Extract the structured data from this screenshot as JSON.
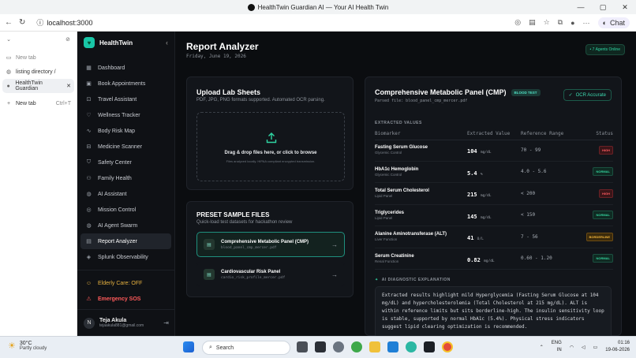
{
  "browser": {
    "window_title": "HealthTwin Guardian AI — Your AI Health Twin",
    "url": "localhost:3000",
    "chat_label": "Chat",
    "tabs": [
      {
        "label": "New tab"
      },
      {
        "label": "listing directory /"
      },
      {
        "label": "HealthTwin Guardian"
      },
      {
        "label": "New tab",
        "shortcut": "Ctrl+T"
      }
    ]
  },
  "app": {
    "brand": "HealthTwin",
    "nav": [
      {
        "label": "Dashboard",
        "icon": "grid-icon"
      },
      {
        "label": "Book Appointments",
        "icon": "calendar-icon"
      },
      {
        "label": "Travel Assistant",
        "icon": "suitcase-icon"
      },
      {
        "label": "Wellness Tracker",
        "icon": "heart-icon"
      },
      {
        "label": "Body Risk Map",
        "icon": "pulse-icon"
      },
      {
        "label": "Medicine Scanner",
        "icon": "scan-icon"
      },
      {
        "label": "Safety Center",
        "icon": "shield-icon"
      },
      {
        "label": "Family Health",
        "icon": "users-icon"
      },
      {
        "label": "AI Assistant",
        "icon": "globe-icon"
      },
      {
        "label": "Mission Control",
        "icon": "target-icon"
      },
      {
        "label": "AI Agent Swarm",
        "icon": "globe-icon"
      },
      {
        "label": "Report Analyzer",
        "icon": "file-icon",
        "active": true
      },
      {
        "label": "Splunk Observability",
        "icon": "layers-icon"
      }
    ],
    "elder_care": "Elderly Care: OFF",
    "sos": "Emergency SOS",
    "user": {
      "initial": "N",
      "name": "Teja Akula",
      "email": "tejaakula881@gmail.com"
    }
  },
  "page": {
    "title": "Report Analyzer",
    "date": "Friday, June 19, 2026",
    "agents_badge": "• 7 Agents Online",
    "upload": {
      "title": "Upload Lab Sheets",
      "subtitle": "PDF, JPG, PNG formats supported. Automated OCR parsing.",
      "drop_text": "Drag & drop files here, or click to browse",
      "privacy": "Files analyzed locally. HIPAA compliant encrypted transmission."
    },
    "presets": {
      "title": "PRESET SAMPLE FILES",
      "subtitle": "Quick-load test datasets for hackathon review",
      "items": [
        {
          "name": "Comprehensive Metabolic Panel (CMP)",
          "file": "blood_panel_cmp_mercer.pdf"
        },
        {
          "name": "Cardiovascular Risk Panel",
          "file": "cardio_risk_profile_mercer.pdf"
        }
      ]
    },
    "report": {
      "title": "Comprehensive Metabolic Panel (CMP)",
      "tag": "BLOOD TEST",
      "parsed_file": "Parsed file: blood_panel_cmp_mercer.pdf",
      "ocr_label": "OCR Accurate",
      "extracted_label": "EXTRACTED VALUES",
      "columns": [
        "Biomarker",
        "Extracted Value",
        "Reference Range",
        "Status"
      ],
      "rows": [
        {
          "name": "Fasting Serum Glucose",
          "category": "Glycemic Control",
          "value": "104",
          "unit": "mg/dL",
          "range": "70 - 99",
          "status": "HIGH",
          "cls": "b-high"
        },
        {
          "name": "HbA1c Hemoglobin",
          "category": "Glycemic Control",
          "value": "5.4",
          "unit": "%",
          "range": "4.0 - 5.6",
          "status": "NORMAL",
          "cls": "b-normal"
        },
        {
          "name": "Total Serum Cholesterol",
          "category": "Lipid Panel",
          "value": "215",
          "unit": "mg/dL",
          "range": "< 200",
          "status": "HIGH",
          "cls": "b-high"
        },
        {
          "name": "Triglycerides",
          "category": "Lipid Panel",
          "value": "145",
          "unit": "mg/dL",
          "range": "< 150",
          "status": "NORMAL",
          "cls": "b-normal"
        },
        {
          "name": "Alanine Aminotransferase (ALT)",
          "category": "Liver Function",
          "value": "41",
          "unit": "U/L",
          "range": "7 - 56",
          "status": "BORDERLINE",
          "cls": "b-border"
        },
        {
          "name": "Serum Creatinine",
          "category": "Renal Function",
          "value": "0.82",
          "unit": "mg/dL",
          "range": "0.60 - 1.20",
          "status": "NORMAL",
          "cls": "b-normal"
        }
      ],
      "ai_label": "AI DIAGNOSTIC EXPLANATION",
      "ai_text": "Extracted results highlight mild Hyperglycemia (Fasting Serum Glucose at 104 mg/dL) and hypercholesterolemia (Total Cholesterol at 215 mg/dL). ALT is within reference limits but sits borderline-high. The insulin sensitivity loop is stable, supported by normal HbA1c (5.4%). Physical stress indicators suggest lipid clearing optimization is recommended."
    }
  },
  "taskbar": {
    "temp": "30°C",
    "weather": "Partly cloudy",
    "search": "Search",
    "lang1": "ENG",
    "lang2": "IN",
    "time": "01:16",
    "date": "19-06-2026"
  }
}
